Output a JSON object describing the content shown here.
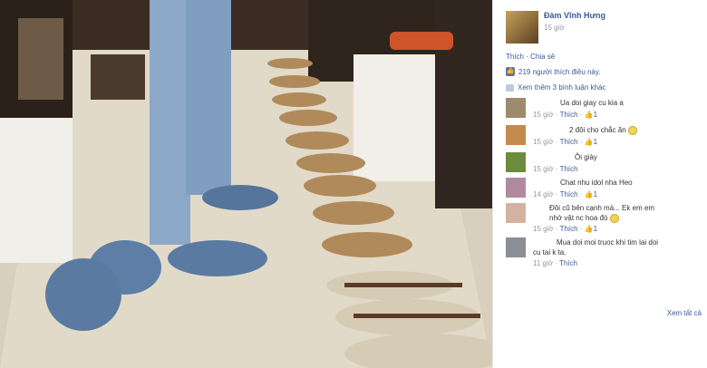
{
  "post": {
    "author": "Đàm Vĩnh Hưng",
    "time": "15 giờ",
    "actions": "Thích · Chia sẻ",
    "likes_text": "219 người thích điều này.",
    "more_comments": "Xem thêm 3 bình luận khác"
  },
  "comments": [
    {
      "text": "Ua doi giay cu kia a",
      "time": "15 giờ",
      "like": "Thích",
      "count": "1",
      "avatar_color": "#9e8b6b"
    },
    {
      "text": "2 đôi cho chắc ăn",
      "time": "15 giờ",
      "like": "Thích",
      "count": "1",
      "avatar_color": "#c58a4e",
      "emoji": true
    },
    {
      "text": "Ôi giày",
      "time": "15 giờ",
      "like": "Thích",
      "count": "",
      "avatar_color": "#6b8c3d"
    },
    {
      "text": "Chat nhu idol nha Heo",
      "time": "14 giờ",
      "like": "Thích",
      "count": "1",
      "avatar_color": "#b28aa0"
    },
    {
      "text": "Đôi cũ bên cạnh mà... Ek em em",
      "text2": "nhớ vật nc hoa đó",
      "time": "15 giờ",
      "like": "Thích",
      "count": "1",
      "avatar_color": "#d1b3a0",
      "emoji": true
    },
    {
      "text": "Mua doi moi truoc khi tim lai doi",
      "text2": "cu tai k ta.",
      "time": "11 giờ",
      "like": "Thích",
      "count": "",
      "avatar_color": "#8a8f96"
    }
  ],
  "view_all": "Xem tất cả",
  "colors": {
    "link": "#3b5998",
    "meta": "#9197a3"
  }
}
